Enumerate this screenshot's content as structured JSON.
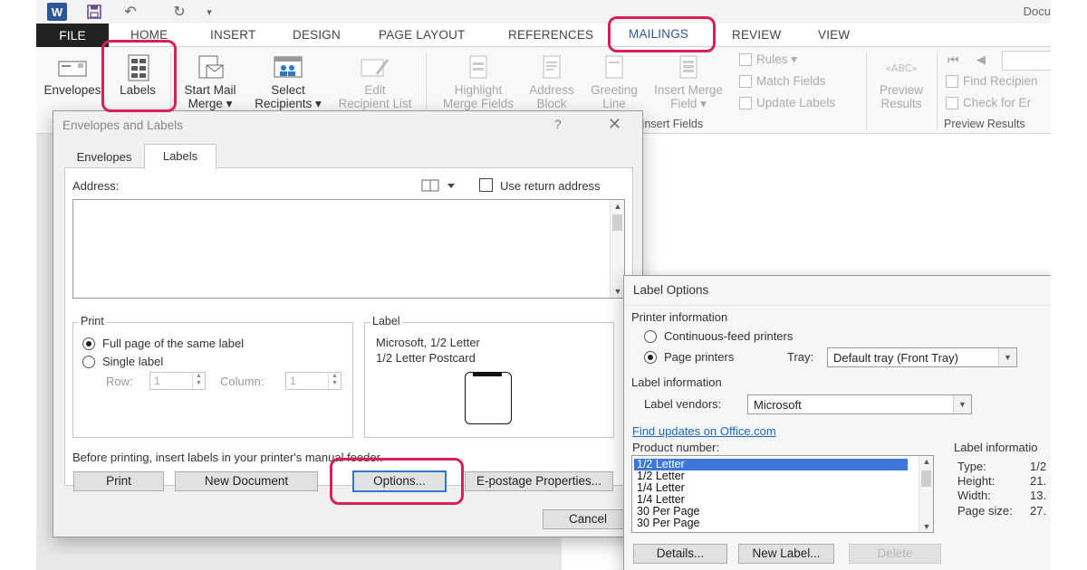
{
  "quick_access": {
    "logo": "W",
    "doc_title": "Docu"
  },
  "tabs": [
    "FILE",
    "HOME",
    "INSERT",
    "DESIGN",
    "PAGE LAYOUT",
    "REFERENCES",
    "MAILINGS",
    "REVIEW",
    "VIEW"
  ],
  "active_tab": "MAILINGS",
  "ribbon": {
    "envelopes": "Envelopes",
    "labels": "Labels",
    "start_mail": [
      "Start Mail",
      "Merge ▾"
    ],
    "select_recipients": [
      "Select",
      "Recipients ▾"
    ],
    "edit_recipients": [
      "Edit",
      "Recipient List"
    ],
    "highlight": [
      "Highlight",
      "Merge Fields"
    ],
    "address_block": [
      "Address",
      "Block"
    ],
    "greeting_line": [
      "Greeting",
      "Line"
    ],
    "insert_merge": [
      "Insert Merge",
      "Field ▾"
    ],
    "rules": "Rules ▾",
    "match_fields": "Match Fields",
    "update_labels": "Update Labels",
    "group_insert_fields": "Insert Fields",
    "preview_results": [
      "Preview",
      "Results"
    ],
    "find_recipient": "Find Recipien",
    "check_errors": "Check for Er",
    "group_preview_results": "Preview Results"
  },
  "env_dialog": {
    "title": "Envelopes and Labels",
    "help": "?",
    "close": "✕",
    "tabs": [
      "Envelopes",
      "Labels"
    ],
    "active_tab": "Labels",
    "address_label": "Address:",
    "use_return_address": "Use return address",
    "use_return_checked": false,
    "print_group": "Print",
    "full_page": "Full page of the same label",
    "single_label": "Single label",
    "row_label": "Row:",
    "row_value": "1",
    "column_label": "Column:",
    "column_value": "1",
    "label_group": "Label",
    "label_line1": "Microsoft, 1/2 Letter",
    "label_line2": "1/2 Letter Postcard",
    "before_printing": "Before printing, insert labels in your printer's manual feeder.",
    "print_btn": "Print",
    "new_document_btn": "New Document",
    "options_btn": "Options...",
    "epostage_btn": "E-postage Properties...",
    "cancel_btn": "Cancel"
  },
  "label_options": {
    "title": "Label Options",
    "printer_info": "Printer information",
    "continuous": "Continuous-feed printers",
    "page_printers": "Page printers",
    "tray_label": "Tray:",
    "tray_value": "Default tray (Front Tray)",
    "label_info": "Label information",
    "vendors_label": "Label vendors:",
    "vendor_value": "Microsoft",
    "find_updates": "Find updates on Office.com",
    "product_number": "Product number:",
    "products": [
      "1/2 Letter",
      "1/2 Letter",
      "1/4 Letter",
      "1/4 Letter",
      "30 Per Page",
      "30 Per Page"
    ],
    "selected_index": 0,
    "info_heading": "Label informatio",
    "type_label": "Type:",
    "type_value": "1/2",
    "height_label": "Height:",
    "height_value": "21.",
    "width_label": "Width:",
    "width_value": "13.",
    "page_size_label": "Page size:",
    "page_size_value": "27.",
    "details_btn": "Details...",
    "new_label_btn": "New Label...",
    "delete_btn": "Delete"
  },
  "colors": {
    "highlight": "#d81e5b",
    "accent": "#2b579a",
    "selection": "#3b78d8",
    "link": "#1a66c2"
  }
}
